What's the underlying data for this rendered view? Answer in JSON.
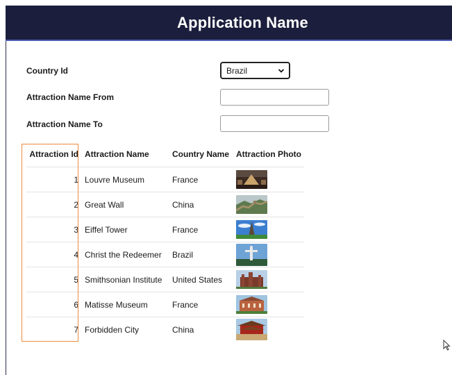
{
  "app": {
    "title": "Application Name"
  },
  "form": {
    "country_id_label": "Country Id",
    "country_selected": "Brazil",
    "name_from_label": "Attraction Name From",
    "name_from_value": "",
    "name_to_label": "Attraction Name To",
    "name_to_value": ""
  },
  "grid": {
    "headers": {
      "id": "Attraction Id",
      "name": "Attraction Name",
      "country": "Country Name",
      "photo": "Attraction Photo"
    },
    "rows": [
      {
        "id": "1",
        "name": "Louvre Museum",
        "country": "France",
        "photo_icon": "louvre-photo"
      },
      {
        "id": "2",
        "name": "Great Wall",
        "country": "China",
        "photo_icon": "great-wall-photo"
      },
      {
        "id": "3",
        "name": "Eiffel Tower",
        "country": "France",
        "photo_icon": "eiffel-tower-photo"
      },
      {
        "id": "4",
        "name": "Christ the Redeemer",
        "country": "Brazil",
        "photo_icon": "christ-redeemer-photo"
      },
      {
        "id": "5",
        "name": "Smithsonian Institute",
        "country": "United States",
        "photo_icon": "smithsonian-photo"
      },
      {
        "id": "6",
        "name": "Matisse Museum",
        "country": "France",
        "photo_icon": "matisse-museum-photo"
      },
      {
        "id": "7",
        "name": "Forbidden City",
        "country": "China",
        "photo_icon": "forbidden-city-photo"
      }
    ]
  },
  "colors": {
    "header_bg": "#1b1e3c",
    "header_accent": "#4b5ab4",
    "highlight": "#ef8a3d"
  }
}
